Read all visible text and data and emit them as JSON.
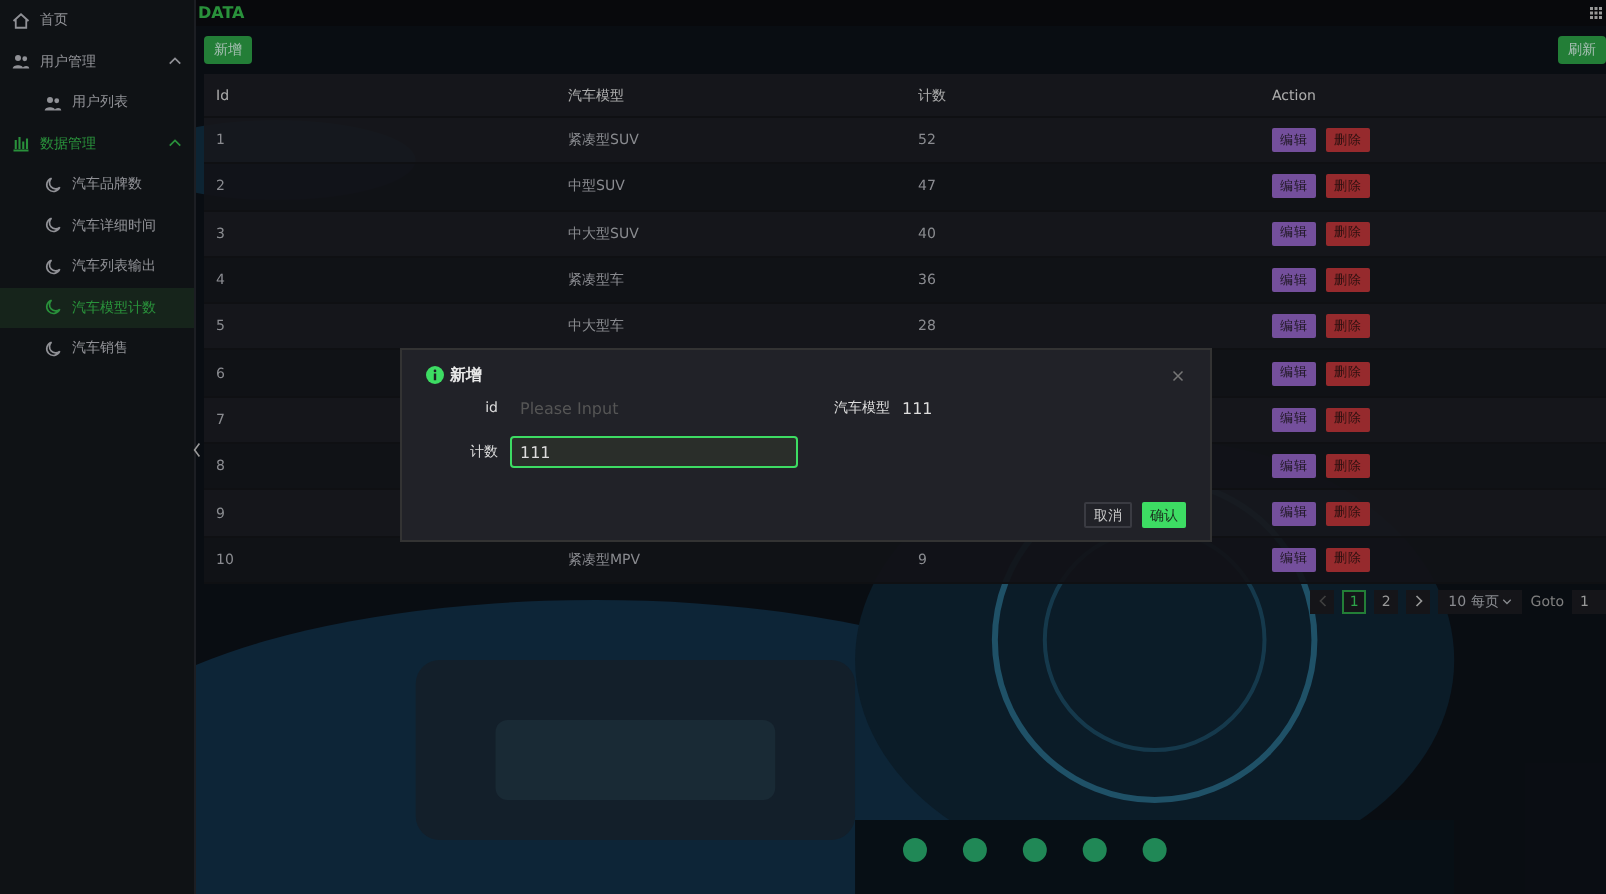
{
  "sidebar": {
    "items": [
      {
        "label": "首页",
        "selected": false
      },
      {
        "label": "用户管理",
        "expanded": true,
        "selected": false,
        "children": [
          {
            "label": "用户列表",
            "selected": false
          }
        ]
      },
      {
        "label": "数据管理",
        "expanded": true,
        "selected": true,
        "children": [
          {
            "label": "汽车品牌数",
            "selected": false
          },
          {
            "label": "汽车详细时间",
            "selected": false
          },
          {
            "label": "汽车列表输出",
            "selected": false
          },
          {
            "label": "汽车模型计数",
            "selected": true
          },
          {
            "label": "汽车销售",
            "selected": false
          }
        ]
      }
    ]
  },
  "header": {
    "title": "DATA"
  },
  "toolbar": {
    "add_button": "新增",
    "refresh_button": "刷新"
  },
  "table": {
    "columns": [
      "Id",
      "汽车模型",
      "计数",
      "Action"
    ],
    "rows": [
      {
        "id": "1",
        "model": "紧凑型SUV",
        "count": "52",
        "edit": "编辑",
        "delete": "删除"
      },
      {
        "id": "2",
        "model": "中型SUV",
        "count": "47",
        "edit": "编辑",
        "delete": "删除"
      },
      {
        "id": "3",
        "model": "中大型SUV",
        "count": "40",
        "edit": "编辑",
        "delete": "删除"
      },
      {
        "id": "4",
        "model": "紧凑型车",
        "count": "36",
        "edit": "编辑",
        "delete": "删除"
      },
      {
        "id": "5",
        "model": "中大型车",
        "count": "28",
        "edit": "编辑",
        "delete": "删除"
      },
      {
        "id": "6",
        "edit": "编辑",
        "delete": "删除"
      },
      {
        "id": "7",
        "edit": "编辑",
        "delete": "删除"
      },
      {
        "id": "8",
        "edit": "编辑",
        "delete": "删除"
      },
      {
        "id": "9",
        "edit": "编辑",
        "delete": "删除"
      },
      {
        "id": "10",
        "model": "紧凑型MPV",
        "count": "9",
        "edit": "编辑",
        "delete": "删除"
      }
    ]
  },
  "pagination": {
    "pages": [
      {
        "label": "1",
        "selected": true
      },
      {
        "label": "2",
        "selected": false
      }
    ],
    "prev_disabled": true,
    "page_size": "10 每页",
    "goto_label": "Goto",
    "goto_value": "1"
  },
  "dialog": {
    "title": "新增",
    "fields": [
      {
        "kind": "input",
        "label": "id",
        "placeholder": "Please Input",
        "focused": false
      },
      {
        "kind": "text",
        "label": "汽车模型",
        "value": "111"
      },
      {
        "kind": "input",
        "label": "计数",
        "value": "111",
        "focused": true
      }
    ],
    "cancel_button": "取消",
    "confirm_button": "确认"
  }
}
